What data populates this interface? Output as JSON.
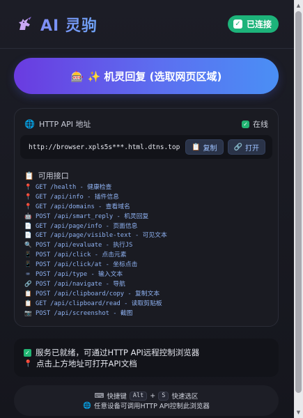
{
  "header": {
    "title": "AI 灵驹",
    "status": "已连接",
    "status_color": "#1db37a"
  },
  "main_button": {
    "label": "🎰 ✨ 机灵回复 (选取网页区域)"
  },
  "api": {
    "label": "HTTP API 地址",
    "online": "在线",
    "url": "http://browser.xpls5s***.html.dtns.top",
    "copy": "复制",
    "open": "打开",
    "endpoints_title": "可用接口",
    "endpoints": [
      {
        "icon": "pin-icon",
        "glyph": "📍",
        "text": "GET /health - 健康检查"
      },
      {
        "icon": "pin-icon",
        "glyph": "📍",
        "text": "GET /api/info - 插件信息"
      },
      {
        "icon": "pin-icon",
        "glyph": "📍",
        "text": "GET /api/domains - 查看域名"
      },
      {
        "icon": "robot-icon",
        "glyph": "🤖",
        "text": "POST /api/smart_reply - 机灵回复"
      },
      {
        "icon": "page-icon",
        "glyph": "📄",
        "text": "GET /api/page/info - 页面信息"
      },
      {
        "icon": "page-icon",
        "glyph": "📄",
        "text": "GET /api/page/visible-text - 可见文本"
      },
      {
        "icon": "magnifier-icon",
        "glyph": "🔍",
        "text": "POST /api/evaluate - 执行JS"
      },
      {
        "icon": "phone-icon",
        "glyph": "📱",
        "text": "POST /api/click - 点击元素"
      },
      {
        "icon": "phone-icon",
        "glyph": "📱",
        "text": "POST /api/click/at - 坐标点击"
      },
      {
        "icon": "keyboard-icon",
        "glyph": "⌨",
        "text": "POST /api/type - 输入文本"
      },
      {
        "icon": "link-icon",
        "glyph": "🔗",
        "text": "POST /api/navigate - 导航"
      },
      {
        "icon": "clipboard-icon",
        "glyph": "📋",
        "text": "POST /api/clipboard/copy - 复制文本"
      },
      {
        "icon": "clipboard-icon",
        "glyph": "📋",
        "text": "GET /api/clipboard/read - 读取剪贴板"
      },
      {
        "icon": "camera-icon",
        "glyph": "📷",
        "text": "POST /api/screenshot - 截图"
      }
    ]
  },
  "status": {
    "line1": "服务已就绪，可通过HTTP API远程控制浏览器",
    "line2": "点击上方地址可打开API文档"
  },
  "footer": {
    "shortcut_label": "快捷键",
    "key1": "Alt",
    "plus": "+",
    "key2": "S",
    "shortcut_action": "快速选区",
    "line2": "任意设备可调用HTTP API控制此浏览器"
  },
  "colors": {
    "accent_gradient_start": "#6a3be0",
    "accent_gradient_end": "#4a8ff5",
    "endpoint_text": "#8fb2f2"
  }
}
